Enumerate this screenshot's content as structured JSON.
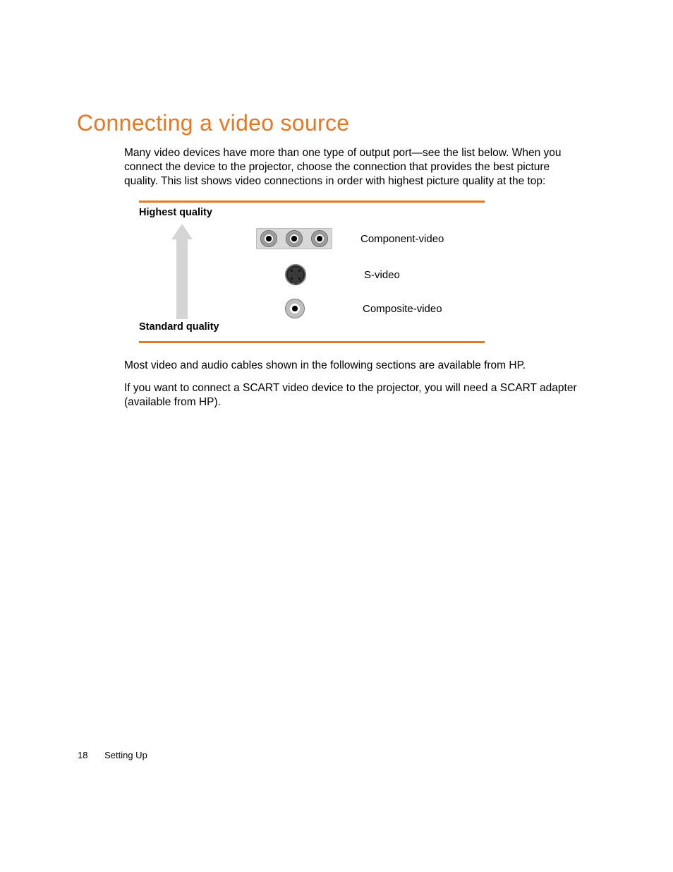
{
  "heading": "Connecting a video source",
  "paragraphs": {
    "intro": "Many video devices have more than one type of output port—see the list below. When you connect the device to the projector, choose the connection that provides the best picture quality. This list shows video connections in order with highest picture quality at the top:",
    "after1": "Most video and audio cables shown in the following sections are available from HP.",
    "after2": "If you want to connect a SCART video device to the projector, you will need a SCART adapter (available from HP)."
  },
  "diagram": {
    "top_label": "Highest quality",
    "bottom_label": "Standard quality",
    "rows": [
      {
        "label": "Component-video"
      },
      {
        "label": "S-video"
      },
      {
        "label": "Composite-video"
      }
    ]
  },
  "footer": {
    "page_number": "18",
    "section": "Setting Up"
  },
  "colors": {
    "accent": "#e87722"
  }
}
